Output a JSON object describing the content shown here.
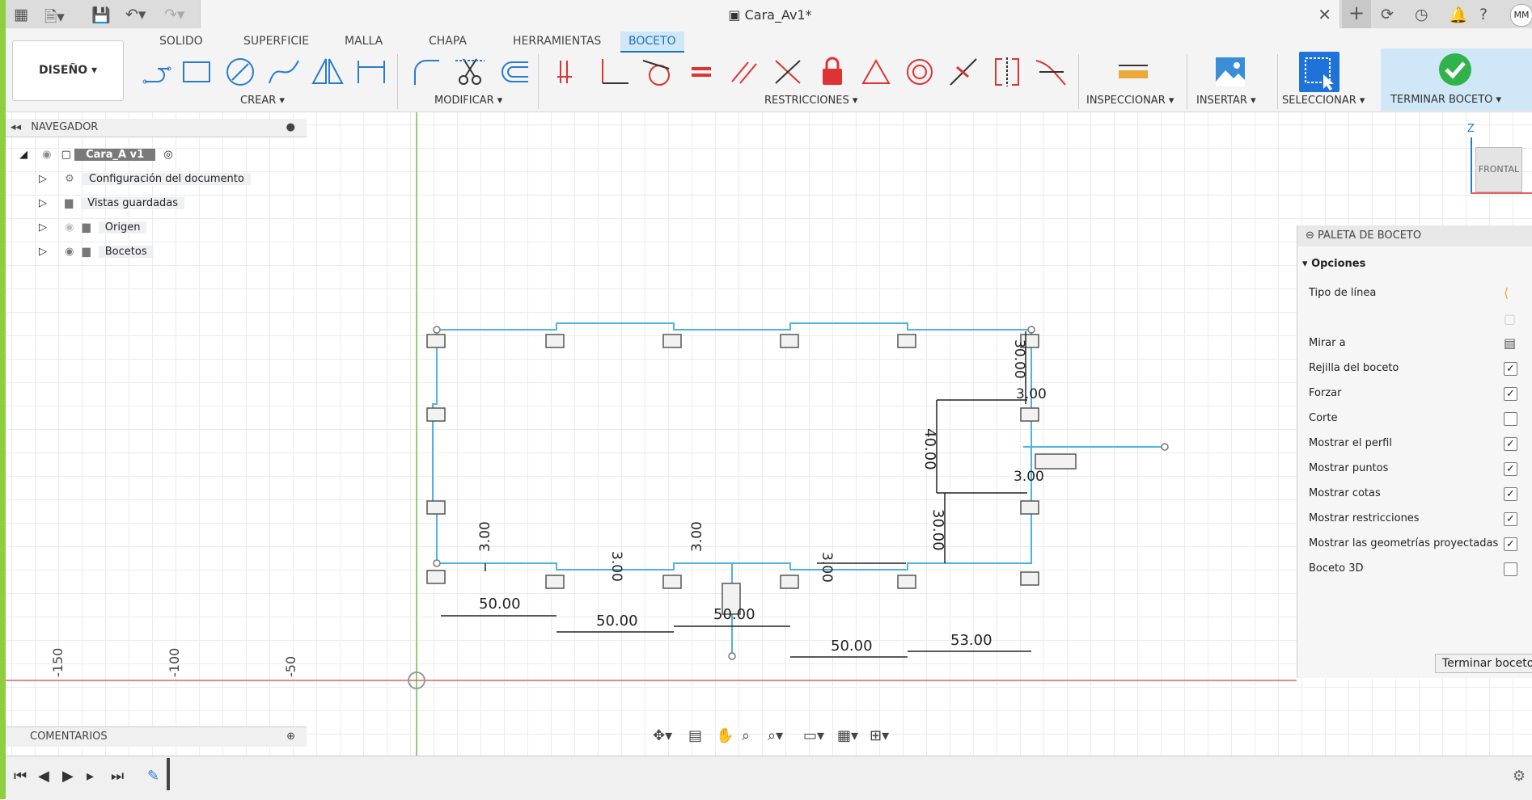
{
  "window": {
    "title": "Cara_Av1*",
    "user_initials": "MM"
  },
  "ribbon": {
    "workspace": "DISEÑO ▾",
    "tabs": [
      "SOLIDO",
      "SUPERFICIE",
      "MALLA",
      "CHAPA",
      "HERRAMIENTAS",
      "BOCETO"
    ],
    "active_tab": "BOCETO",
    "groups": {
      "crear": "CREAR ▾",
      "modificar": "MODIFICAR ▾",
      "restricciones": "RESTRICCIONES ▾",
      "inspeccionar": "INSPECCIONAR ▾",
      "insertar": "INSERTAR ▾",
      "seleccionar": "SELECCIONAR ▾",
      "terminar": "TERMINAR BOCETO ▾"
    }
  },
  "navigator": {
    "title": "NAVEGADOR",
    "component": "Cara_A v1",
    "items": [
      {
        "label": "Configuración del documento",
        "icon": "gear-icon"
      },
      {
        "label": "Vistas guardadas",
        "icon": "folder-icon"
      },
      {
        "label": "Origen",
        "icon": "folder-icon"
      },
      {
        "label": "Bocetos",
        "icon": "folder-icon"
      }
    ]
  },
  "viewcube": {
    "label": "FRONTAL",
    "axis": "Z"
  },
  "palette": {
    "title": "PALETA DE BOCETO",
    "section": "Opciones",
    "rows": [
      {
        "label": "Tipo de línea",
        "kind": "icon"
      },
      {
        "label": "Mirar a",
        "kind": "icon"
      },
      {
        "label": "Rejilla del boceto",
        "checked": "✓"
      },
      {
        "label": "Forzar",
        "checked": "✓"
      },
      {
        "label": "Corte",
        "checked": ""
      },
      {
        "label": "Mostrar el perfil",
        "checked": "✓"
      },
      {
        "label": "Mostrar puntos",
        "checked": "✓"
      },
      {
        "label": "Mostrar cotas",
        "checked": "✓"
      },
      {
        "label": "Mostrar restricciones",
        "checked": "✓"
      },
      {
        "label": "Mostrar las geometrías proyectadas",
        "checked": "✓"
      },
      {
        "label": "Boceto 3D",
        "checked": ""
      }
    ],
    "finish_button": "Terminar boceto"
  },
  "comments": {
    "title": "COMENTARIOS"
  },
  "rulers": [
    "-150",
    "-100",
    "-50"
  ],
  "dimensions": {
    "d1": "50.00",
    "d2": "50.00",
    "d3": "50.00",
    "d4": "50.00",
    "d5": "53.00",
    "d40": "40.00",
    "d30": "30.00",
    "dtop": "30.00",
    "d3a": "3.00",
    "d3b": "3.00",
    "d3c": "3.00",
    "d3d": "3.00",
    "d3e": "3.00",
    "d3f": "3.00"
  },
  "colors": {
    "accent": "#1e73d8",
    "sketch": "#4fb3e0",
    "green_axis": "#67c04a",
    "red_axis": "#e06060"
  }
}
